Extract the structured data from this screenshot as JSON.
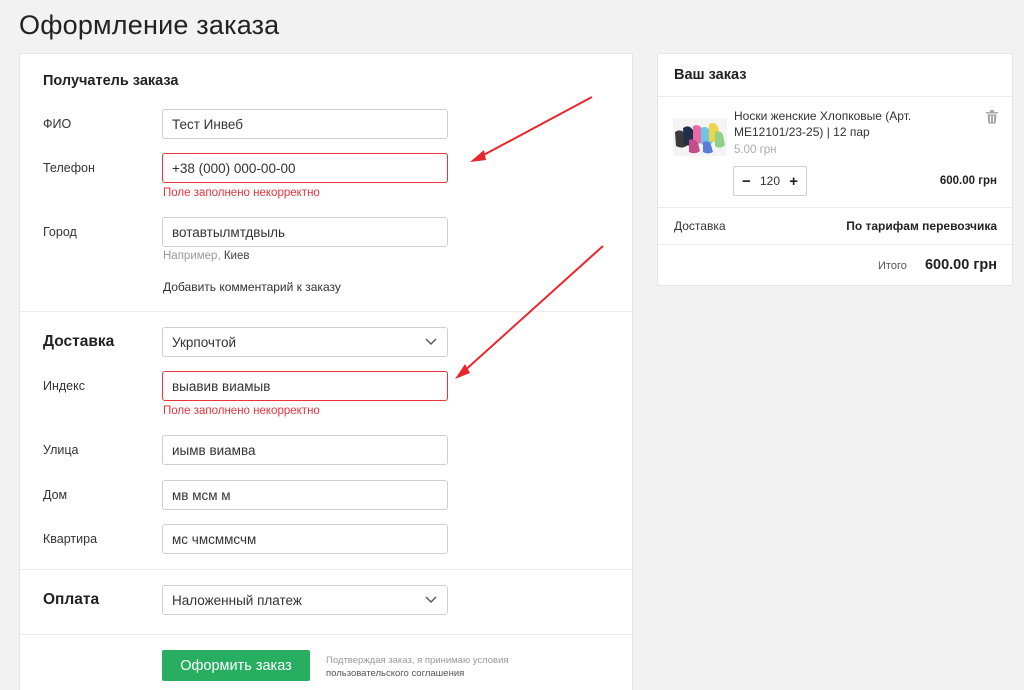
{
  "page": {
    "title": "Оформление заказа"
  },
  "recipient": {
    "title": "Получатель заказа",
    "name_label": "ФИО",
    "name_value": "Тест Инвеб",
    "phone_label": "Телефон",
    "phone_value": "+38 (000) 000-00-00",
    "phone_error": "Поле заполнено некорректно",
    "city_label": "Город",
    "city_value": "вотавтылмтдвыль",
    "city_hint_prefix": "Например,",
    "city_hint_example": "Киев",
    "comment_link": "Добавить комментарий к заказу"
  },
  "delivery": {
    "title": "Доставка",
    "method_value": "Укрпочтой",
    "index_label": "Индекс",
    "index_value": "выавив виамыв",
    "index_error": "Поле заполнено некорректно",
    "street_label": "Улица",
    "street_value": "иымв виамва",
    "house_label": "Дом",
    "house_value": "мв мсм м",
    "apt_label": "Квартира",
    "apt_value": "мс чмсммсчм"
  },
  "payment": {
    "title": "Оплата",
    "method_value": "Наложенный платеж"
  },
  "submit": {
    "label": "Оформить заказ",
    "terms_line1": "Подтверждая заказ, я принимаю условия",
    "terms_line2": "пользовательского соглашения"
  },
  "order": {
    "title": "Ваш заказ",
    "product_name": "Носки женские Хлопковые (Арт. ME12101/23-25) | 12 пар",
    "product_price": "5.00 грн",
    "quantity": "120",
    "line_total": "600.00 грн",
    "delivery_label": "Доставка",
    "delivery_value": "По тарифам перевозчика",
    "total_label": "Итого",
    "total_value": "600.00 грн"
  },
  "colors": {
    "accent": "#27ae60",
    "error": "#e8343a",
    "annotation_arrow": "#e8262c"
  },
  "icons": [
    "minus-icon",
    "plus-icon",
    "trash-icon",
    "chevron-down-icon",
    "annotation-arrow"
  ]
}
